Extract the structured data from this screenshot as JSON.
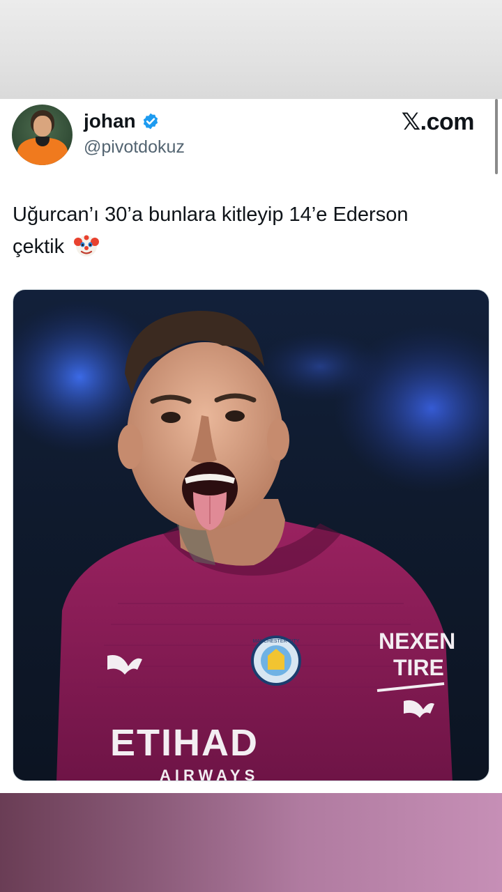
{
  "tweet": {
    "display_name": "johan",
    "handle": "@pivotdokuz",
    "source": "𝕏.com",
    "text_line1": "Uğurcan’ı 30’a bunlara kitleyip 14’e Ederson",
    "text_line2": "çektik",
    "emoji": "clown-face-icon",
    "verified": true
  },
  "media": {
    "sponsor_chest": "ETIHAD",
    "sponsor_chest_sub": "AIRWAYS",
    "sleeve_sponsor_line1": "NEXEN",
    "sleeve_sponsor_line2": "TIRE",
    "crest_text": "MANCHESTER CITY"
  },
  "colors": {
    "verified_blue": "#1d9bf0",
    "jersey": "#8b1c56",
    "background_blur": "#1a3a8a"
  }
}
